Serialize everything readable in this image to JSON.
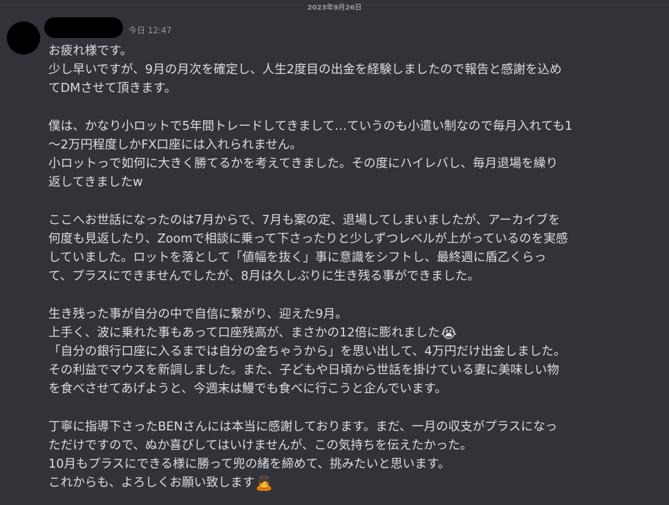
{
  "date_divider": "2023年9月26日",
  "message": {
    "timestamp": "今日 12:47",
    "lines": [
      "お疲れ様です。",
      "少し早いですが、9月の月次を確定し、人生2度目の出金を経験しましたので報告と感謝を込め",
      "てDMさせて頂きます。",
      "",
      "僕は、かなり小ロットで5年間トレードしてきまして…ていうのも小遣い制なので毎月入れても1",
      "〜2万円程度しかFX口座には入れられません。",
      "小ロットっで如何に大きく勝てるかを考えてきました。その度にハイレバし、毎月退場を繰り",
      "返してきましたw",
      "",
      "ここへお世話になったのは7月からで、7月も案の定、退場してしまいましたが、アーカイブを",
      "何度も見返したり、Zoomで相談に乗って下さったりと少しずつレベルが上がっているのを実感",
      "していました。ロットを落として「値幅を抜く」事に意識をシフトし、最終週に盾乙くらっ",
      "て、プラスにできませんでしたが、8月は久しぶりに生き残る事ができました。",
      "",
      "生き残った事が自分の中で自信に繋がり、迎えた9月。",
      "上手く、波に乗れた事もあって口座残高が、まさかの12倍に膨れました",
      "「自分の銀行口座に入るまでは自分の金ちゃうから」を思い出して、4万円だけ出金しました。",
      "その利益でマウスを新調しました。また、子どもや日頃から世話を掛けている妻に美味しい物",
      "を食べさせてあげようと、今週末は鰻でも食べに行こうと企んでいます。",
      "",
      "丁寧に指導下さったBENさんには本当に感謝しております。まだ、一月の収支がプラスになっ",
      "ただけですので、ぬか喜びしてはいけませんが、この気持ちを伝えたかった。",
      "10月もプラスにできる様に勝って兜の緒を締めて、挑みたいと思います。",
      "これからも、よろしくお願い致します"
    ],
    "emojis": {
      "crying_face": "😭",
      "bowing_person": "🙇"
    }
  },
  "colors": {
    "background": "#313338",
    "message_text": "#dbdee1",
    "muted_text": "#949ba4"
  }
}
